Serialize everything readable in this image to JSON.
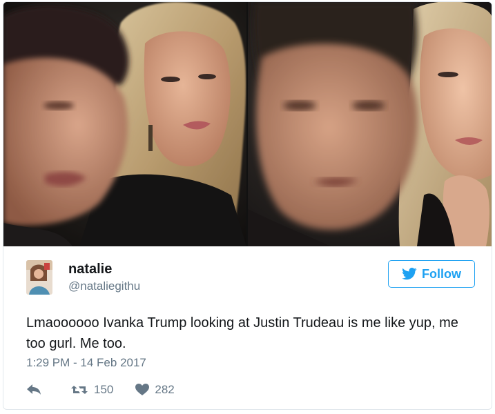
{
  "tweet": {
    "display_name": "natalie",
    "handle": "@nataliegithu",
    "follow_label": "Follow",
    "text": "Lmaoooooo Ivanka Trump looking at Justin Trudeau is me like yup, me too gurl. Me too.",
    "timestamp": "1:29 PM - 14 Feb 2017",
    "retweet_count": "150",
    "like_count": "282"
  },
  "icons": {
    "follow": "twitter-bird-icon",
    "reply": "reply-arrow-icon",
    "retweet": "retweet-icon",
    "like": "heart-icon"
  },
  "colors": {
    "accent": "#1da1f2",
    "text": "#14171a",
    "secondary_text": "#657786",
    "border": "#e1e8ed"
  }
}
